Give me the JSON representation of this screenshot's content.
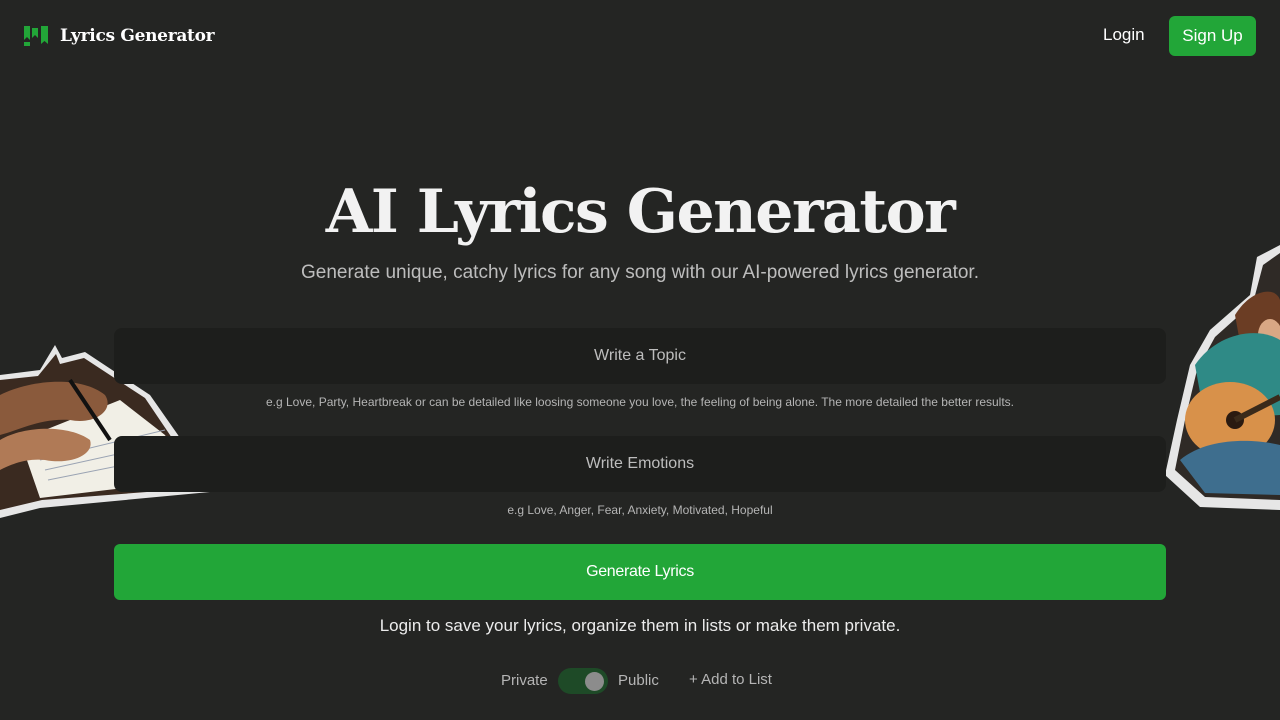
{
  "brand": {
    "name": "Lyrics Generator",
    "icon": "lyrics-logo-icon",
    "accent_color": "#22a638"
  },
  "nav": {
    "login_label": "Login",
    "signup_label": "Sign Up"
  },
  "hero": {
    "title": "AI Lyrics Generator",
    "subtitle": "Generate unique, catchy lyrics for any song with our AI-powered lyrics generator."
  },
  "form": {
    "topic": {
      "placeholder": "Write a Topic",
      "value": "",
      "hint": "e.g Love, Party, Heartbreak or can be detailed like loosing someone you love, the feeling of being alone. The more detailed the better results."
    },
    "emotions": {
      "placeholder": "Write Emotions",
      "value": "",
      "hint": "e.g Love, Anger, Fear, Anxiety, Motivated, Hopeful"
    },
    "generate_label": "Generate Lyrics"
  },
  "login_note": "Login to save your lyrics, organize them in lists or make them private.",
  "visibility": {
    "private_label": "Private",
    "public_label": "Public",
    "selected": "Public",
    "add_to_list_label": "+ Add to List"
  },
  "decorations": {
    "left_image": "hands-writing-lyrics-image",
    "right_image": "woman-playing-guitar-image"
  }
}
